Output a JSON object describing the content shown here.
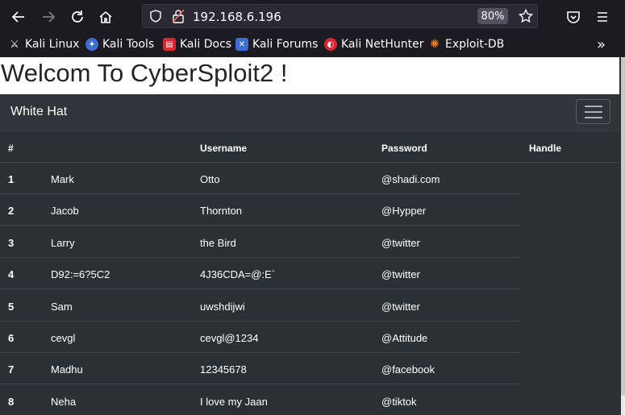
{
  "browser": {
    "url": "192.168.6.196",
    "zoom": "80%",
    "bookmarks": [
      {
        "label": "Kali Linux",
        "icon": "kali-dragon-icon"
      },
      {
        "label": "Kali Tools",
        "icon": "kali-tools-icon"
      },
      {
        "label": "Kali Docs",
        "icon": "kali-docs-icon"
      },
      {
        "label": "Kali Forums",
        "icon": "kali-forums-icon"
      },
      {
        "label": "Kali NetHunter",
        "icon": "kali-nethunter-icon"
      },
      {
        "label": "Exploit-DB",
        "icon": "exploit-db-icon"
      }
    ]
  },
  "page": {
    "heading": "Welcom To CyberSploit2 !",
    "brand": "White Hat",
    "table": {
      "headers": [
        "#",
        "Username",
        "Password",
        "Handle"
      ],
      "rows": [
        {
          "num": "1",
          "name": "Mark",
          "username": "Otto",
          "password": "@shadi.com"
        },
        {
          "num": "2",
          "name": "Jacob",
          "username": "Thornton",
          "password": "@Hypper"
        },
        {
          "num": "3",
          "name": "Larry",
          "username": "the Bird",
          "password": "@twitter"
        },
        {
          "num": "4",
          "name": "D92:=6?5C2",
          "username": "4J36CDA=@:E`",
          "password": "@twitter"
        },
        {
          "num": "5",
          "name": "Sam",
          "username": "uwshdijwi",
          "password": "@twitter"
        },
        {
          "num": "6",
          "name": "cevgl",
          "username": "cevgl@1234",
          "password": "@Attitude"
        },
        {
          "num": "7",
          "name": "Madhu",
          "username": "12345678",
          "password": "@facebook"
        },
        {
          "num": "8",
          "name": "Neha",
          "username": "I love my Jaan",
          "password": "@tiktok"
        }
      ]
    }
  }
}
